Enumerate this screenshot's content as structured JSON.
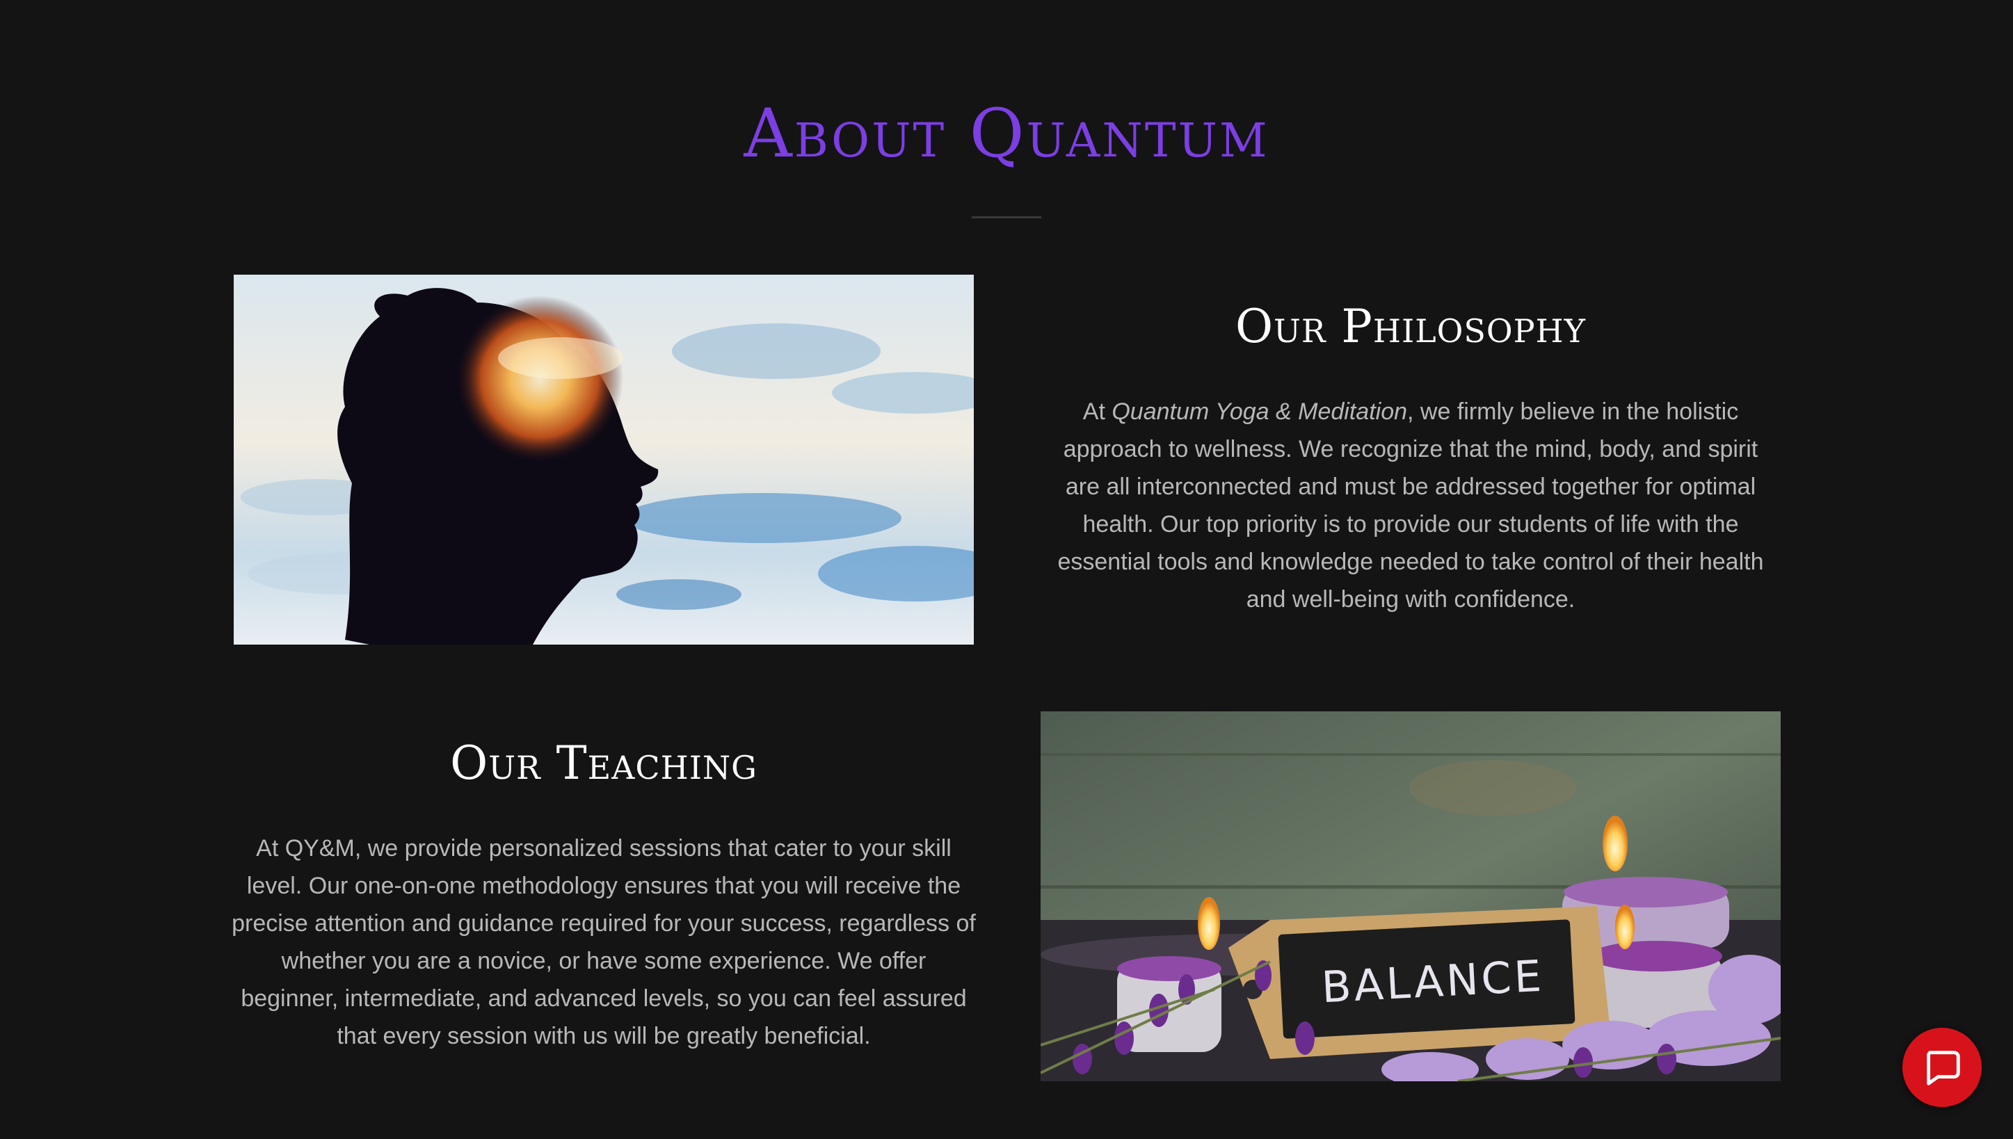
{
  "about": {
    "title": "About Quantum",
    "title_color": "#7b3fe4"
  },
  "philosophy": {
    "heading": "Our Philosophy",
    "text_before": "At ",
    "text_emphasis": "Quantum Yoga & Meditation",
    "text_after": ", we firmly believe in the holistic approach to wellness. We recognize that the mind, body, and spirit are all interconnected and must be addressed together for optimal health. Our top priority is to provide our students of life with the essential tools and knowledge needed to take control of their health and well-being with confidence."
  },
  "teaching": {
    "heading": "Our Teaching",
    "text": "At QY&M, we provide personalized sessions that cater to your skill level. Our one-on-one methodology ensures that you will receive the precise attention and guidance required for your success, regardless of whether you are a novice, or have some experience. We offer beginner, intermediate, and advanced levels, so you can feel assured that every session with us will be greatly beneficial."
  },
  "images": {
    "balance_sign": "BALANCE"
  },
  "chat": {
    "icon": "chat-bubble-icon",
    "button_color": "#d8121b"
  }
}
